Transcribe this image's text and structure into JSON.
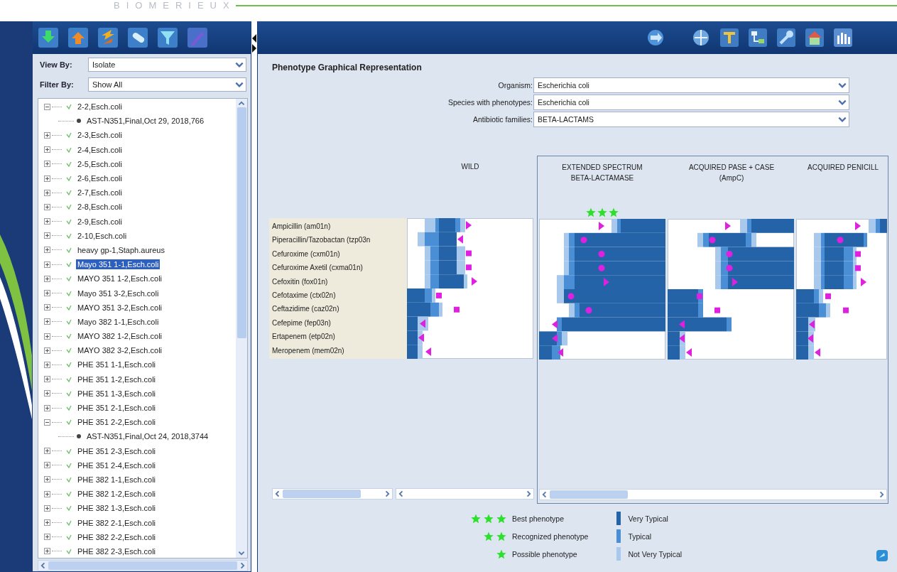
{
  "brand": {
    "logo": "BIOMERIEUX"
  },
  "left_panel": {
    "view_by": {
      "label": "View By:",
      "value": "Isolate"
    },
    "filter_by": {
      "label": "Filter By:",
      "value": "Show All"
    }
  },
  "tree": [
    {
      "label": "2-2,Esch.coli",
      "expanded": true,
      "selected": false,
      "children": [
        {
          "label": "AST-N351,Final,Oct 29, 2018,766",
          "selected": false
        }
      ]
    },
    {
      "label": "2-3,Esch.coli",
      "expanded": false,
      "selected": false
    },
    {
      "label": "2-4,Esch.coli",
      "expanded": false,
      "selected": false
    },
    {
      "label": "2-5,Esch.coli",
      "expanded": false,
      "selected": false
    },
    {
      "label": "2-6,Esch.coli",
      "expanded": false,
      "selected": false
    },
    {
      "label": "2-7,Esch.coli",
      "expanded": false,
      "selected": false
    },
    {
      "label": "2-8,Esch.coli",
      "expanded": false,
      "selected": false
    },
    {
      "label": "2-9,Esch.coli",
      "expanded": false,
      "selected": false
    },
    {
      "label": "2-10,Esch.coli",
      "expanded": false,
      "selected": false
    },
    {
      "label": "heavy gp-1,Staph.aureus",
      "expanded": false,
      "selected": false
    },
    {
      "label": "Mayo 351 1-1,Esch.coli",
      "expanded": false,
      "selected": true
    },
    {
      "label": "MAYO 351 1-2,Esch.coli",
      "expanded": false,
      "selected": false
    },
    {
      "label": "Mayo 351 3-2,Esch.coli",
      "expanded": false,
      "selected": false
    },
    {
      "label": "MAYO 351 3-2,Esch.coli",
      "expanded": false,
      "selected": false
    },
    {
      "label": "Mayo 382 1-1,Esch.coli",
      "expanded": false,
      "selected": false
    },
    {
      "label": "MAYO 382 1-2,Esch.coli",
      "expanded": false,
      "selected": false
    },
    {
      "label": "MAYO 382 3-2,Esch.coli",
      "expanded": false,
      "selected": false
    },
    {
      "label": "PHE 351 1-1,Esch.coli",
      "expanded": false,
      "selected": false
    },
    {
      "label": "PHE 351 1-2,Esch.coli",
      "expanded": false,
      "selected": false
    },
    {
      "label": "PHE 351 1-3,Esch.coli",
      "expanded": false,
      "selected": false
    },
    {
      "label": "PHE 351 2-1,Esch.coli",
      "expanded": false,
      "selected": false
    },
    {
      "label": "PHE 351 2-2,Esch.coli",
      "expanded": true,
      "selected": false,
      "children": [
        {
          "label": "AST-N351,Final,Oct 24, 2018,3744",
          "selected": false
        }
      ]
    },
    {
      "label": "PHE 351 2-3,Esch.coli",
      "expanded": false,
      "selected": false
    },
    {
      "label": "PHE 351 2-4,Esch.coli",
      "expanded": false,
      "selected": false
    },
    {
      "label": "PHE 382 1-1,Esch.coli",
      "expanded": false,
      "selected": false
    },
    {
      "label": "PHE 382 1-2,Esch.coli",
      "expanded": false,
      "selected": false
    },
    {
      "label": "PHE 382 1-3,Esch.coli",
      "expanded": false,
      "selected": false
    },
    {
      "label": "PHE 382 2-1,Esch.coli",
      "expanded": false,
      "selected": false
    },
    {
      "label": "PHE 382 2-2,Esch.coli",
      "expanded": false,
      "selected": false
    },
    {
      "label": "PHE 382 2-3,Esch.coli",
      "expanded": false,
      "selected": false
    }
  ],
  "phenotype": {
    "title": "Phenotype Graphical Representation",
    "fields": [
      {
        "label": "Organism:",
        "value": "Escherichia coli"
      },
      {
        "label": "Species with phenotypes:",
        "value": "Escherichia coli"
      },
      {
        "label": "Antibiotic families:",
        "value": "BETA-LACTAMS"
      }
    ],
    "columns": [
      {
        "header": [
          "WILD"
        ]
      },
      {
        "header": [
          "EXTENDED SPECTRUM",
          "BETA-LACTAMASE"
        ],
        "stars": 3
      },
      {
        "header": [
          "ACQUIRED PASE + CASE",
          "(AmpC)"
        ]
      },
      {
        "header": [
          "ACQUIRED PENICILL"
        ]
      }
    ],
    "antibiotics": [
      "Ampicillin (am01n)",
      "Piperacillin/Tazobactan (tzp03n",
      "Cefuroxime (cxm01n)",
      "Cefuroxime Axetil (cxma01n)",
      "Cefoxitin (fox01n)",
      "Cefotaxime (ctx02n)",
      "Ceftazidime (caz02n)",
      "Cefepime (fep03n)",
      "Ertapenem (etp02n)",
      "Meropenem (mem02n)"
    ]
  },
  "legend": {
    "phenotypes": [
      {
        "kind": "best",
        "label": "Best phenotype"
      },
      {
        "kind": "recognized",
        "label": "Recognized phenotype"
      },
      {
        "kind": "possible",
        "label": "Possible phenotype"
      }
    ],
    "typicality": [
      {
        "label": "Very Typical",
        "color": "#2563a8"
      },
      {
        "label": "Typical",
        "color": "#4a8fd6"
      },
      {
        "label": "Not Very Typical",
        "color": "#a9c9ec"
      }
    ]
  }
}
